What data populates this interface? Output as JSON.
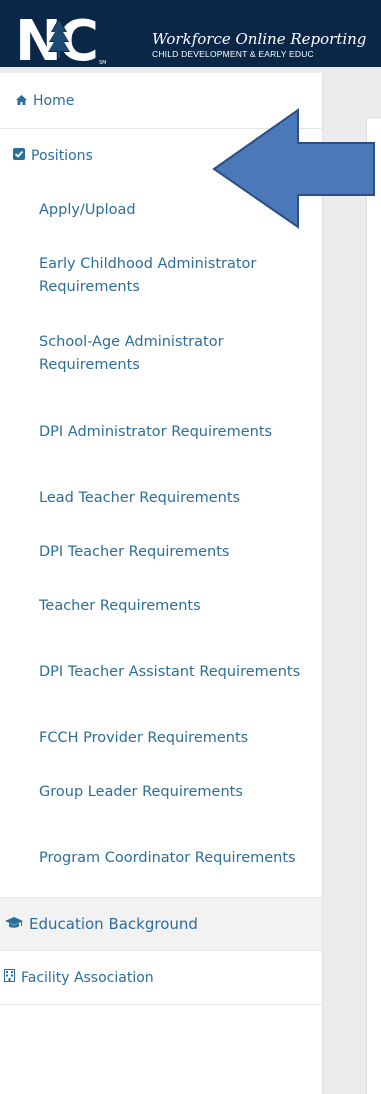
{
  "header": {
    "logo_text": "NC",
    "title": "Workforce Online Reporting",
    "subtitle": "CHILD DEVELOPMENT & EARLY EDUC"
  },
  "sidebar": {
    "home": {
      "label": "Home",
      "icon": "home-icon"
    },
    "positions": {
      "label": "Positions",
      "icon": "checkbox-icon"
    },
    "position_items": [
      "Apply/Upload",
      "Early Childhood Administrator Requirements",
      "School-Age Administrator Requirements",
      "DPI Administrator Requirements",
      "Lead Teacher Requirements",
      "DPI Teacher Requirements",
      "Teacher Requirements",
      "DPI Teacher Assistant Requirements",
      "FCCH Provider Requirements",
      "Group Leader Requirements",
      "Program Coordinator Requirements"
    ],
    "education": {
      "label": "Education Background",
      "icon": "graduation-cap-icon"
    },
    "facility": {
      "label": "Facility Association",
      "icon": "building-icon"
    }
  },
  "colors": {
    "header_bg": "#0b2747",
    "link": "#2c6e9b",
    "arrow_fill": "#4a78b8",
    "arrow_stroke": "#2b4f82"
  }
}
